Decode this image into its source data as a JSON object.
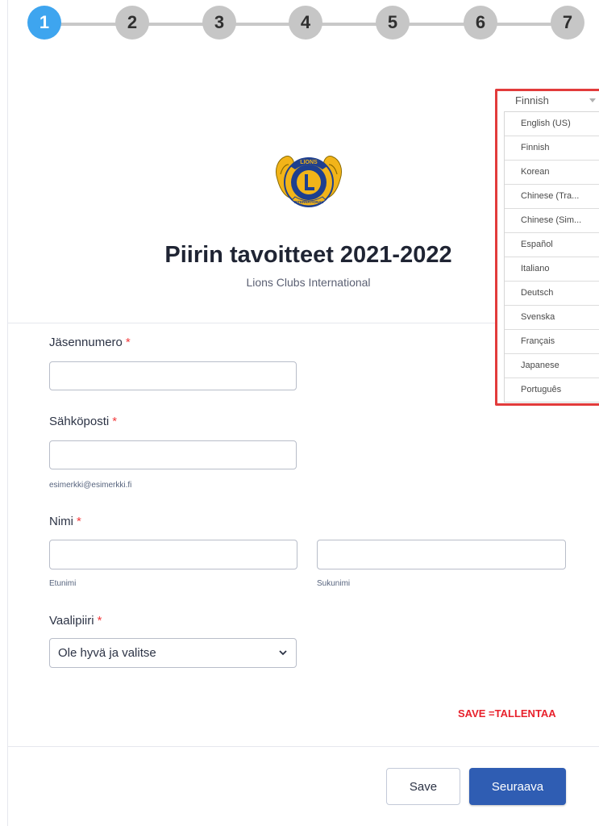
{
  "stepper": {
    "steps": [
      "1",
      "2",
      "3",
      "4",
      "5",
      "6",
      "7"
    ],
    "active_index": 0
  },
  "header": {
    "logo_alt": "Lions Clubs International logo",
    "title": "Piirin tavoitteet 2021-2022",
    "subtitle": "Lions Clubs International"
  },
  "language": {
    "current": "Finnish",
    "options": [
      "English (US)",
      "Finnish",
      "Korean",
      "Chinese (Tra...",
      "Chinese (Sim...",
      "Español",
      "Italiano",
      "Deutsch",
      "Svenska",
      "Français",
      "Japanese",
      "Português"
    ]
  },
  "fields": {
    "member_number": {
      "label": "Jäsennumero",
      "required_mark": "*",
      "value": ""
    },
    "email": {
      "label": "Sähköposti",
      "required_mark": "*",
      "value": "",
      "sublabel": "esimerkki@esimerkki.fi"
    },
    "name": {
      "label": "Nimi",
      "required_mark": "*",
      "first_sublabel": "Etunimi",
      "last_sublabel": "Sukunimi"
    },
    "district": {
      "label": "Vaalipiiri",
      "required_mark": "*",
      "selected": "Ole hyvä ja valitse"
    }
  },
  "note": "SAVE =TALLENTAA",
  "buttons": {
    "save": "Save",
    "next": "Seuraava"
  },
  "colors": {
    "accent": "#3ea5ef",
    "primary_button": "#2f5db3",
    "required": "#f23a3c",
    "highlight_border": "#e23b3b"
  }
}
